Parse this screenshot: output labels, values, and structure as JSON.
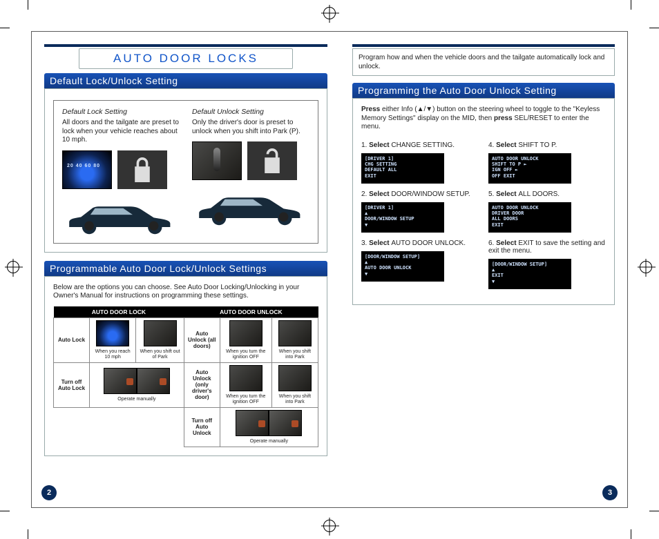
{
  "pageNumbers": {
    "left": "2",
    "right": "3"
  },
  "title": "AUTO DOOR LOCKS",
  "intro_right": "Program how and when the vehicle doors and the tailgate automatically lock and unlock.",
  "left": {
    "sect1": {
      "head": "Default Lock/Unlock Setting",
      "lock": {
        "h": "Default Lock Setting",
        "t": "All doors and the tailgate are preset to lock when your vehicle reaches about 10 mph."
      },
      "unlock": {
        "h": "Default Unlock Setting",
        "t": "Only the driver's door is preset to unlock when you shift into Park (P)."
      }
    },
    "sect2": {
      "head": "Programmable Auto Door Lock/Unlock Settings",
      "intro": "Below are the options you can choose. See Auto Door Locking/Unlocking in your Owner's Manual for instructions on programming these settings.",
      "th1": "AUTO DOOR LOCK",
      "th2": "AUTO DOOR UNLOCK",
      "r1a": "Auto Lock",
      "r1b": "When you reach 10 mph",
      "r1c": "When you shift out of Park",
      "r1d": "Auto Unlock (all doors)",
      "r1e": "When you turn the ignition OFF",
      "r1f": "When you shift into Park",
      "r2a": "Turn off Auto Lock",
      "r2b": "Operate manually",
      "r2d": "Auto Unlock (only driver's door)",
      "r2e": "When you turn the ignition OFF",
      "r2f": "When you shift into Park",
      "r3d": "Turn off Auto Unlock",
      "r3e": "Operate manually"
    }
  },
  "right": {
    "head": "Programming the Auto Door Unlock Setting",
    "lead_a": "Press",
    "lead_b": " either Info (▲/▼) button on the steering wheel to toggle to the \"Keyless Memory Settings\" display on the MID, then ",
    "lead_c": "press",
    "lead_d": " SEL/RESET to enter the menu.",
    "s1": {
      "n": "1. ",
      "b": "Select ",
      "t": "CHANGE SETTING.",
      "mid": "[DRIVER 1]\nCHG SETTING\nDEFAULT ALL\nEXIT"
    },
    "s2": {
      "n": "2. ",
      "b": "Select ",
      "t": "DOOR/WINDOW SETUP.",
      "mid": "[DRIVER 1]\n▲\nDOOR/WINDOW SETUP\n▼"
    },
    "s3": {
      "n": "3. ",
      "b": "Select ",
      "t": "AUTO DOOR UNLOCK.",
      "mid": "[DOOR/WINDOW SETUP]\n▲\nAUTO DOOR UNLOCK\n▼"
    },
    "s4": {
      "n": "4. ",
      "b": "Select ",
      "t": "SHIFT TO P.",
      "mid": "AUTO DOOR UNLOCK\nSHIFT TO P ►\nIGN OFF  ►\nOFF    EXIT"
    },
    "s5": {
      "n": "5. ",
      "b": "Select ",
      "t": "ALL DOORS.",
      "mid": "AUTO DOOR UNLOCK\nDRIVER DOOR\nALL DOORS\nEXIT"
    },
    "s6": {
      "n": "6. ",
      "b": "Select ",
      "t": "EXIT to save the setting and exit the menu.",
      "mid": "[DOOR/WINDOW SETUP]\n▲\nEXIT\n▼"
    }
  }
}
